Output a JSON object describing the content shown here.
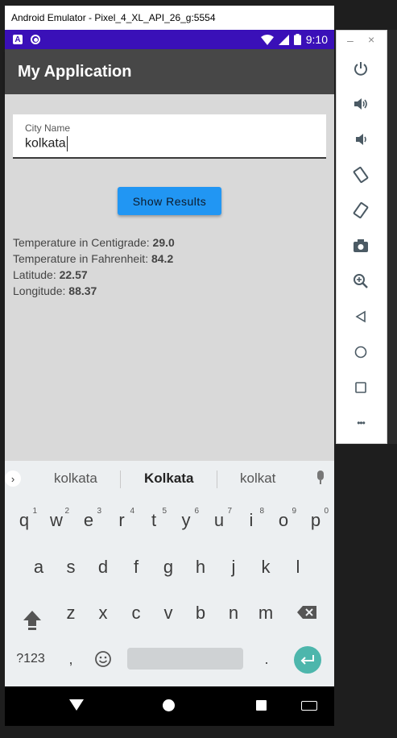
{
  "window": {
    "title": "Android Emulator - Pixel_4_XL_API_26_g:5554"
  },
  "status_bar": {
    "time": "9:10"
  },
  "app": {
    "title": "My Application"
  },
  "form": {
    "city_label": "City Name",
    "city_value": "kolkata",
    "button_label": "Show Results"
  },
  "results": {
    "temp_c_label": "Temperature in Centigrade: ",
    "temp_c_value": "29.0",
    "temp_f_label": "Temperature in Fahrenheit: ",
    "temp_f_value": "84.2",
    "lat_label": "Latitude: ",
    "lat_value": "22.57",
    "lon_label": "Longitude: ",
    "lon_value": "88.37"
  },
  "keyboard": {
    "suggestions": [
      "kolkata",
      "Kolkata",
      "kolkat"
    ],
    "row1": [
      {
        "k": "q",
        "n": "1"
      },
      {
        "k": "w",
        "n": "2"
      },
      {
        "k": "e",
        "n": "3"
      },
      {
        "k": "r",
        "n": "4"
      },
      {
        "k": "t",
        "n": "5"
      },
      {
        "k": "y",
        "n": "6"
      },
      {
        "k": "u",
        "n": "7"
      },
      {
        "k": "i",
        "n": "8"
      },
      {
        "k": "o",
        "n": "9"
      },
      {
        "k": "p",
        "n": "0"
      }
    ],
    "row2": [
      "a",
      "s",
      "d",
      "f",
      "g",
      "h",
      "j",
      "k",
      "l"
    ],
    "row3": [
      "z",
      "x",
      "c",
      "v",
      "b",
      "n",
      "m"
    ],
    "symbols_label": "?123",
    "comma": ",",
    "period": "."
  },
  "sidebar": {
    "minimize": "–",
    "close": "×",
    "more": "•••"
  }
}
